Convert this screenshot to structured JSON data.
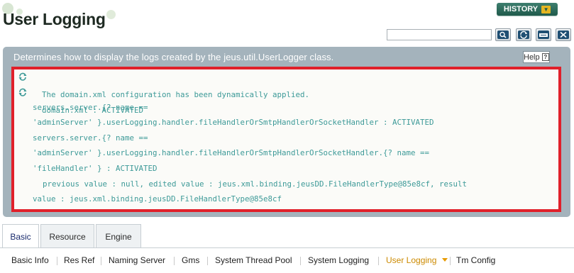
{
  "header": {
    "title": "User Logging",
    "history_label": "HISTORY",
    "search": {
      "value": "",
      "placeholder": ""
    },
    "toolbar_icons": [
      "search-icon",
      "refresh-icon",
      "export-xml-icon",
      "close-icon"
    ]
  },
  "panel": {
    "description": "Determines how to display the logs created by the jeus.util.UserLogger class.",
    "help_label": "Help",
    "messages": [
      {
        "icon": "refresh-icon",
        "text": "The domain.xml configuration has been dynamically applied."
      },
      {
        "icon": "refresh-icon",
        "text": "domain.xml : ACTIVATED"
      },
      {
        "text": "servers.server.{? name =="
      },
      {
        "text": "'adminServer' }.userLogging.handler.fileHandlerOrSmtpHandlerOrSocketHandler : ACTIVATED"
      },
      {
        "text": "servers.server.{? name =="
      },
      {
        "text": "'adminServer' }.userLogging.handler.fileHandlerOrSmtpHandlerOrSocketHandler.{? name =="
      },
      {
        "text": "'fileHandler' } : ACTIVATED"
      },
      {
        "text": "previous value : null, edited value : jeus.xml.binding.jeusDD.FileHandlerType@85e8cf, result"
      },
      {
        "text": "value : jeus.xml.binding.jeusDD.FileHandlerType@85e8cf"
      }
    ]
  },
  "tabs": [
    {
      "label": "Basic",
      "active": true
    },
    {
      "label": "Resource",
      "active": false
    },
    {
      "label": "Engine",
      "active": false
    }
  ],
  "subnav": [
    {
      "label": "Basic Info"
    },
    {
      "label": "Res Ref"
    },
    {
      "label": "Naming Server"
    },
    {
      "label": "Gms"
    },
    {
      "label": "System Thread Pool"
    },
    {
      "label": "System Logging"
    },
    {
      "label": "User Logging",
      "active": true
    },
    {
      "label": "Tm Config"
    }
  ],
  "colors": {
    "panel_bg": "#a4b3bc",
    "message_text": "#3d9a98",
    "highlight_border": "#e0202a",
    "history_bg": "#1f5a4b",
    "active_subnav": "#cc8a00"
  }
}
